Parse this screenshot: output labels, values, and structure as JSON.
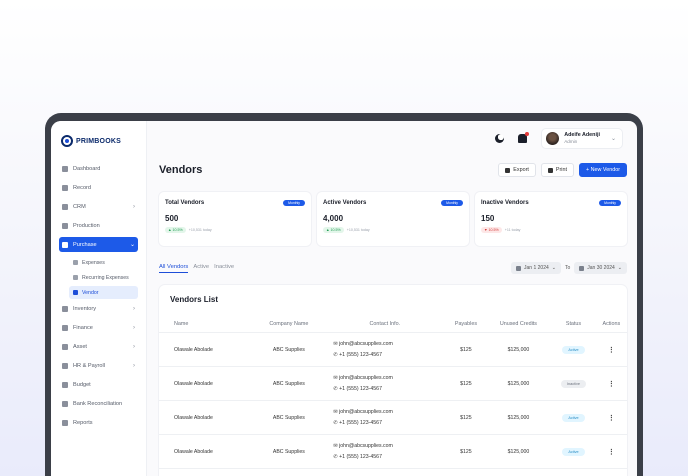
{
  "app": {
    "logo_text": "PRIMBOOKS"
  },
  "sidebar": {
    "items": [
      {
        "label": "Dashboard",
        "chevron": ""
      },
      {
        "label": "Record",
        "chevron": ""
      },
      {
        "label": "CRM",
        "chevron": "›"
      },
      {
        "label": "Production",
        "chevron": ""
      },
      {
        "label": "Purchase",
        "chevron": "⌄"
      }
    ],
    "subitems": [
      {
        "label": "Expenses"
      },
      {
        "label": "Recurring Expenses"
      },
      {
        "label": "Vendor"
      }
    ],
    "items_after": [
      {
        "label": "Inventory",
        "chevron": "›"
      },
      {
        "label": "Finance",
        "chevron": "›"
      },
      {
        "label": "Asset",
        "chevron": "›"
      },
      {
        "label": "HR & Payroll",
        "chevron": "›"
      },
      {
        "label": "Budget",
        "chevron": ""
      },
      {
        "label": "Bank Reconciliation",
        "chevron": ""
      },
      {
        "label": "Reports",
        "chevron": ""
      }
    ]
  },
  "user": {
    "name": "Adeife Adeniji",
    "role": "Admin"
  },
  "page": {
    "title": "Vendors",
    "export_label": "Export",
    "print_label": "Print",
    "new_label": "+ New Vendor"
  },
  "cards": [
    {
      "title": "Total Vendors",
      "badge": "Monthly",
      "value": "500",
      "pct": "▲ 10.5%",
      "trend": "up",
      "note": "+10,531 today"
    },
    {
      "title": "Active Vendors",
      "badge": "Monthly",
      "value": "4,000",
      "pct": "▲ 10.5%",
      "trend": "up",
      "note": "+10,531 today"
    },
    {
      "title": "Inactive  Vendors",
      "badge": "Monthly",
      "value": "150",
      "pct": "▼ 10.5%",
      "trend": "down",
      "note": "+11 today"
    }
  ],
  "filters": {
    "tabs": [
      "All Vendors",
      "Active",
      "Inactive"
    ],
    "from": "Jan 1 2024",
    "to_label": "To",
    "to": "Jan 30 2024"
  },
  "list": {
    "title": "Vendors List",
    "columns": [
      "Name",
      "Company Name",
      "Contact Info.",
      "Payables",
      "Unused Credits",
      "Status",
      "Actions"
    ],
    "rows": [
      {
        "name": "Olawale Abolade",
        "company": "ABC Supplies",
        "email": "john@abcsupplies.com",
        "phone": "+1 (555) 123-4567",
        "payables": "$125",
        "credits": "$125,000",
        "status": "Active"
      },
      {
        "name": "Olawale Abolade",
        "company": "ABC Supplies",
        "email": "john@abcsupplies.com",
        "phone": "+1 (555) 123-4567",
        "payables": "$125",
        "credits": "$125,000",
        "status": "Inactive"
      },
      {
        "name": "Olawale Abolade",
        "company": "ABC Supplies",
        "email": "john@abcsupplies.com",
        "phone": "+1 (555) 123-4567",
        "payables": "$125",
        "credits": "$125,000",
        "status": "Active"
      },
      {
        "name": "Olawale Abolade",
        "company": "ABC Supplies",
        "email": "john@abcsupplies.com",
        "phone": "+1 (555) 123-4567",
        "payables": "$125",
        "credits": "$125,000",
        "status": "Active"
      }
    ],
    "action_glyph": "⋮"
  }
}
